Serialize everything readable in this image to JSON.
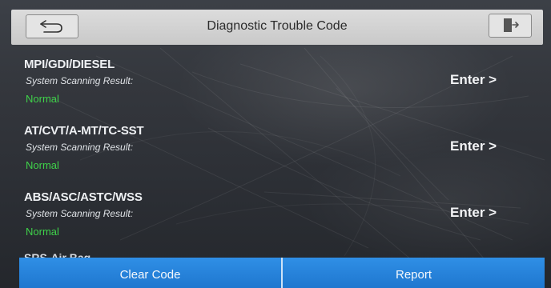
{
  "header": {
    "title": "Diagnostic Trouble Code",
    "back_icon": "back-arrow-icon",
    "exit_icon": "exit-door-icon"
  },
  "systems": [
    {
      "name": "MPI/GDI/DIESEL",
      "scan_label": "System Scanning Result:",
      "status": "Normal",
      "enter_label": "Enter >"
    },
    {
      "name": "AT/CVT/A-MT/TC-SST",
      "scan_label": "System Scanning Result:",
      "status": "Normal",
      "enter_label": "Enter >"
    },
    {
      "name": "ABS/ASC/ASTC/WSS",
      "scan_label": "System Scanning Result:",
      "status": "Normal",
      "enter_label": "Enter >"
    }
  ],
  "partial_system": {
    "name": "SRS-Air Bag"
  },
  "footer": {
    "clear_label": "Clear Code",
    "report_label": "Report"
  },
  "colors": {
    "status_normal": "#3fd24a",
    "footer_blue": "#2384d8",
    "header_bg": "#d4d4d4"
  }
}
